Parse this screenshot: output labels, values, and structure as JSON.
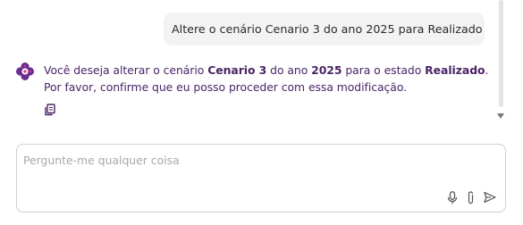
{
  "chat": {
    "user_message": "Altere o cenário Cenario 3 do ano 2025 para Realizado",
    "assistant_message": {
      "part1": "Você deseja alterar o cenário ",
      "scenario": "Cenario 3",
      "part2": " do ano ",
      "year": "2025",
      "part3": " para o estado ",
      "status": "Realizado",
      "part4": ". Por favor, confirme que eu posso proceder com essa modificação."
    }
  },
  "input": {
    "placeholder": "Pergunte-me qualquer coisa",
    "value": ""
  },
  "icons": {
    "assistant_avatar": "assistant-logo-icon",
    "copy": "copy-icon",
    "microphone": "microphone-icon",
    "attach": "paperclip-icon",
    "send": "send-icon"
  },
  "colors": {
    "brand_purple": "#6a2c91",
    "assistant_text": "#4b2466",
    "user_bubble_bg": "#f3f3f3"
  }
}
